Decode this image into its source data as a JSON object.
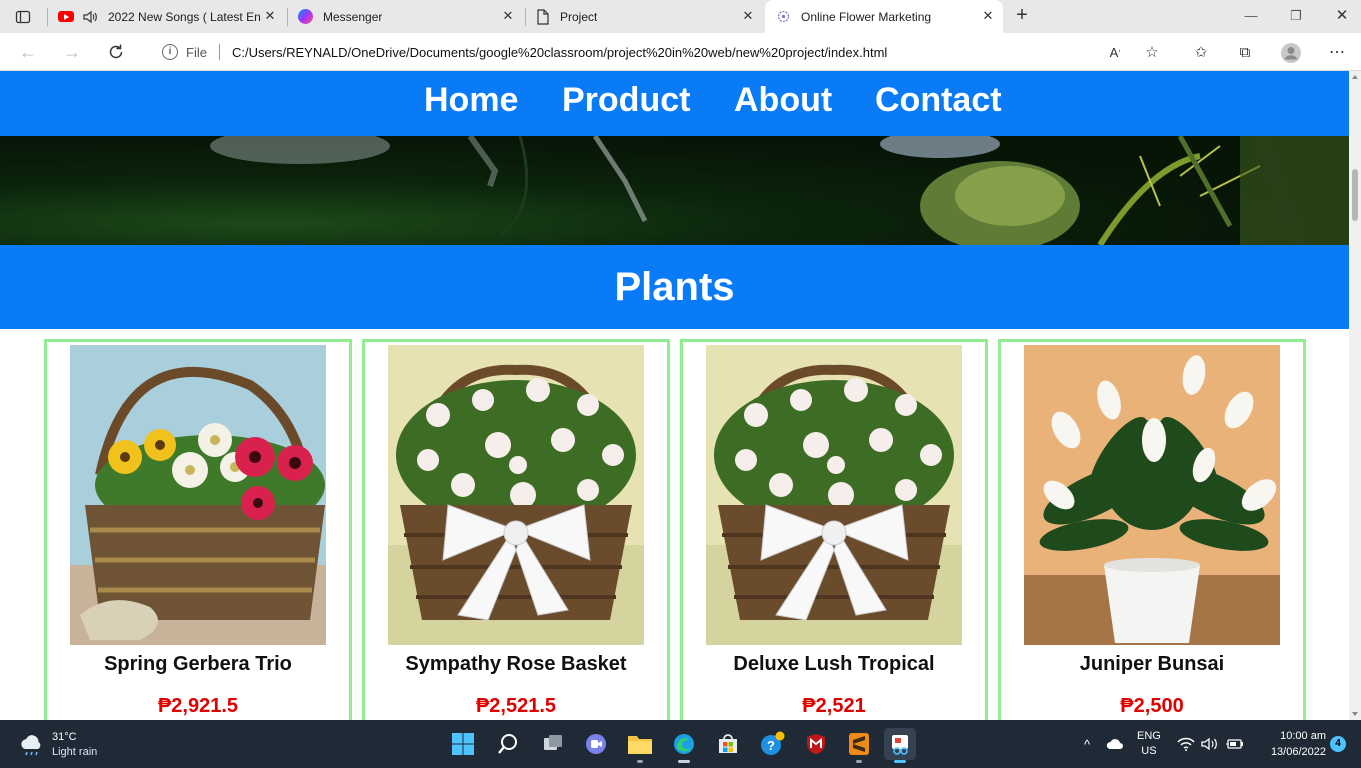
{
  "browser": {
    "tabs": [
      {
        "label": "2022 New Songs ( Latest En",
        "icon": "youtube-icon",
        "active": false
      },
      {
        "label": "Messenger",
        "icon": "messenger-icon",
        "active": false
      },
      {
        "label": "Project",
        "icon": "document-icon",
        "active": false
      },
      {
        "label": "Online Flower Marketing",
        "icon": "flower-favicon-icon",
        "active": true
      }
    ],
    "address": {
      "scheme": "File",
      "url": "C:/Users/REYNALD/OneDrive/Documents/google%20classroom/project%20in%20web/new%20project/index.html"
    }
  },
  "site": {
    "nav": [
      "Home",
      "Product",
      "About",
      "Contact"
    ],
    "section_title": "Plants",
    "products": [
      {
        "name": "Spring Gerbera Trio",
        "price": "₱2,921.5"
      },
      {
        "name": "Sympathy Rose Basket",
        "price": "₱2,521.5"
      },
      {
        "name": "Deluxe Lush Tropical",
        "price": "₱2,521"
      },
      {
        "name": "Juniper Bunsai",
        "price": "₱2,500"
      }
    ]
  },
  "taskbar": {
    "weather": {
      "temp": "31°C",
      "condition": "Light rain"
    },
    "language": {
      "lang": "ENG",
      "region": "US"
    },
    "clock": {
      "time": "10:00 am",
      "date": "13/06/2022"
    },
    "notifications": "4"
  },
  "colors": {
    "nav_blue": "#0a7bf6",
    "card_border": "#90ee90",
    "price_red": "#e00000"
  }
}
